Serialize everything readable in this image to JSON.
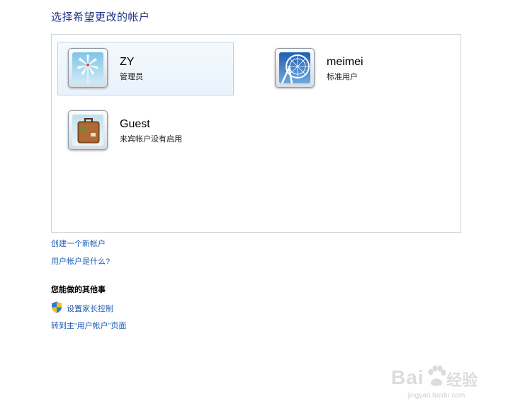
{
  "page": {
    "title": "选择希望更改的帐户"
  },
  "accounts": [
    {
      "name": "ZY",
      "type": "管理员",
      "picture": "windmill-picture",
      "selected": true
    },
    {
      "name": "meimei",
      "type": "标准用户",
      "picture": "ferris-wheel-picture",
      "selected": false
    },
    {
      "name": "Guest",
      "type": "来宾帐户没有启用",
      "picture": "suitcase-picture",
      "selected": false
    }
  ],
  "links": {
    "create_account": "创建一个新帐户",
    "what_is_account": "用户帐户是什么?"
  },
  "other_tasks": {
    "heading": "您能做的其他事",
    "parental_controls": "设置家长控制",
    "parental_controls_icon": "uac-shield-icon",
    "go_to_main": "转到主“用户帐户”页面"
  },
  "watermark": {
    "brand": "Bai",
    "text": "经验",
    "url": "jingyan.baidu.com"
  },
  "colors": {
    "title": "#1e3287",
    "link": "#1e5cb3",
    "selected_tile_border": "#b9d2e9"
  }
}
